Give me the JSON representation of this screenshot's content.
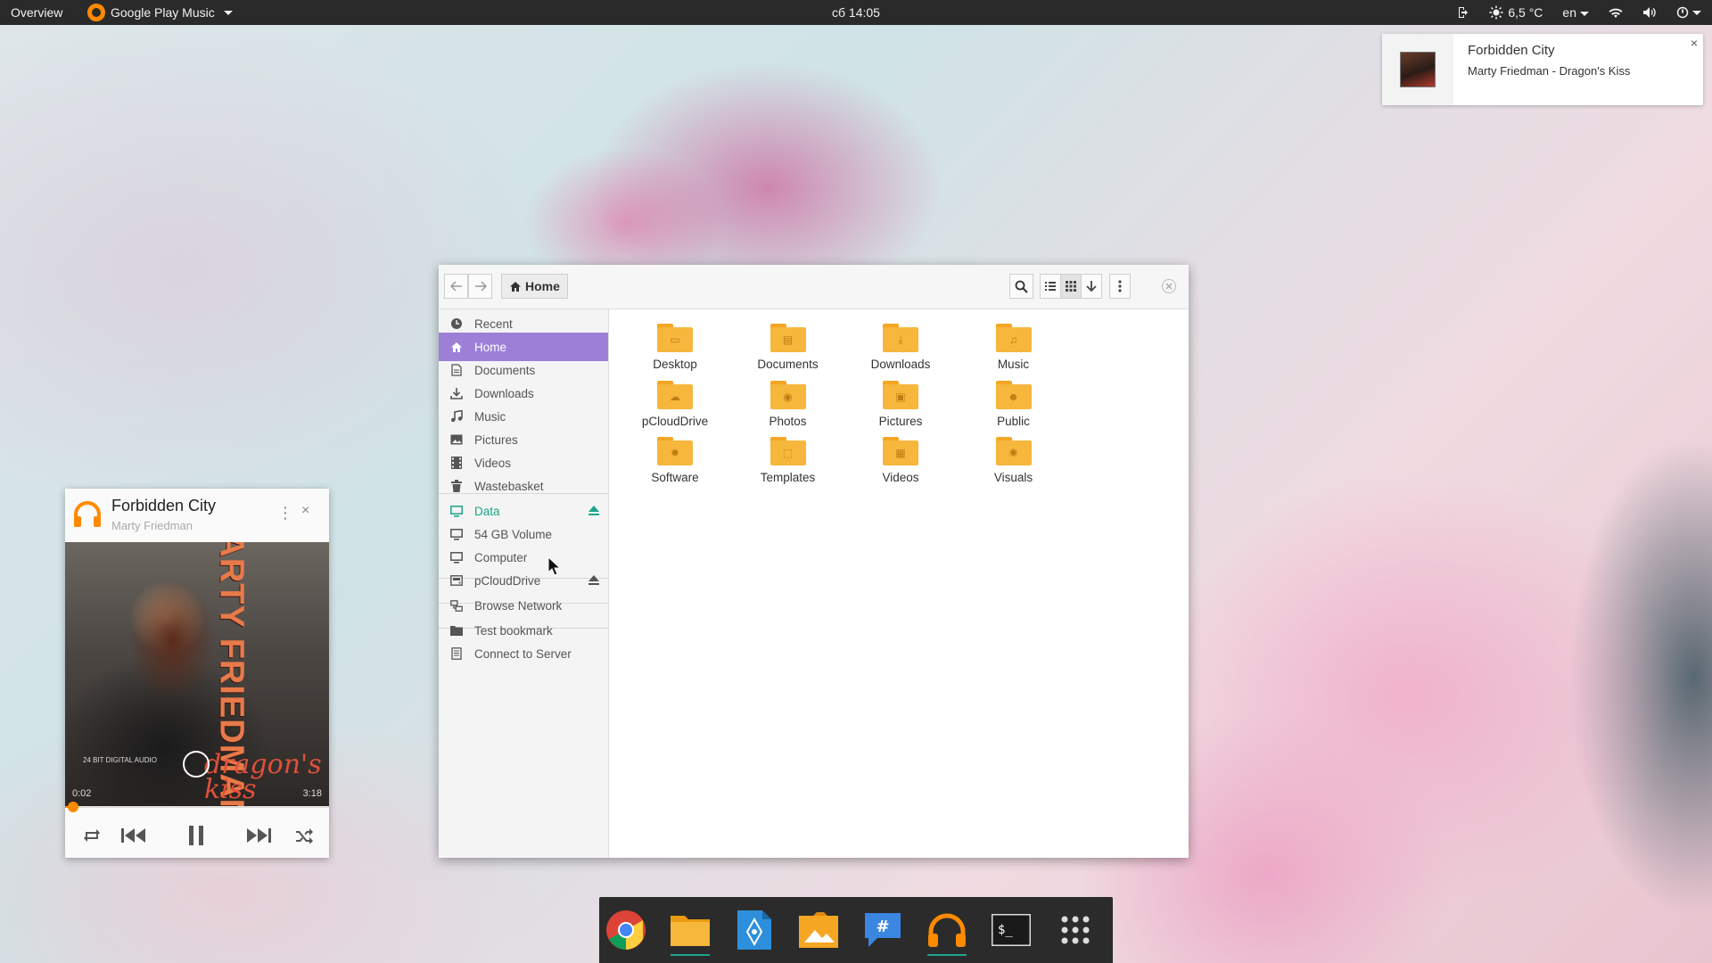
{
  "topbar": {
    "overview": "Overview",
    "app_menu": "Google Play Music",
    "clock": "сб 14:05",
    "weather": "6,5 °C",
    "lang": "en"
  },
  "notification": {
    "title": "Forbidden City",
    "body": "Marty Friedman - Dragon's Kiss",
    "close": "×"
  },
  "player": {
    "title": "Forbidden City",
    "artist": "Marty Friedman",
    "kebab": "⋮",
    "close": "×",
    "album_art": {
      "vertical_text": "MARTY FRIEDMAN",
      "script_text": "dragon's kiss",
      "badge_text": "24 BIT DIGITAL AUDIO",
      "time_left": "0:02",
      "time_right": "3:18"
    },
    "progress": 0.03,
    "accent": "#ff8a00"
  },
  "file_manager": {
    "breadcrumb": "Home",
    "sidebar": [
      {
        "label": "Recent",
        "icon": "clock-icon",
        "state": "normal"
      },
      {
        "label": "Home",
        "icon": "home-icon",
        "state": "active"
      },
      {
        "label": "Documents",
        "icon": "document-icon",
        "state": "normal"
      },
      {
        "label": "Downloads",
        "icon": "download-icon",
        "state": "normal"
      },
      {
        "label": "Music",
        "icon": "music-icon",
        "state": "normal"
      },
      {
        "label": "Pictures",
        "icon": "picture-icon",
        "state": "normal"
      },
      {
        "label": "Videos",
        "icon": "film-icon",
        "state": "normal"
      },
      {
        "label": "Wastebasket",
        "icon": "trash-icon",
        "state": "normal"
      },
      {
        "label": "Data",
        "icon": "monitor-icon",
        "state": "mounted"
      },
      {
        "label": "54 GB Volume",
        "icon": "monitor-icon",
        "state": "normal"
      },
      {
        "label": "Computer",
        "icon": "monitor-icon",
        "state": "normal"
      },
      {
        "label": "pCloudDrive",
        "icon": "drive-icon",
        "state": "normal"
      },
      {
        "label": "Browse Network",
        "icon": "network-icon",
        "state": "normal"
      },
      {
        "label": "Test bookmark",
        "icon": "folder-icon",
        "state": "normal"
      },
      {
        "label": "Connect to Server",
        "icon": "server-icon",
        "state": "normal"
      }
    ],
    "folders": [
      {
        "label": "Desktop",
        "emblem": "desktop"
      },
      {
        "label": "Documents",
        "emblem": "document"
      },
      {
        "label": "Downloads",
        "emblem": "download"
      },
      {
        "label": "Music",
        "emblem": "music"
      },
      {
        "label": "pCloudDrive",
        "emblem": "cloud"
      },
      {
        "label": "Photos",
        "emblem": "camera"
      },
      {
        "label": "Pictures",
        "emblem": "picture"
      },
      {
        "label": "Public",
        "emblem": "people"
      },
      {
        "label": "Software",
        "emblem": "gear"
      },
      {
        "label": "Templates",
        "emblem": "template"
      },
      {
        "label": "Videos",
        "emblem": "film"
      },
      {
        "label": "Visuals",
        "emblem": "palette"
      }
    ],
    "accent": "#9d7fd8",
    "folder_color": "#f7b63c"
  },
  "dock": [
    {
      "name": "chrome",
      "running": false
    },
    {
      "name": "files",
      "running": true
    },
    {
      "name": "text-editor",
      "running": false
    },
    {
      "name": "image-viewer",
      "running": false
    },
    {
      "name": "chat",
      "running": false
    },
    {
      "name": "google-play-music",
      "running": true
    },
    {
      "name": "terminal",
      "running": false
    },
    {
      "name": "app-grid",
      "running": false
    }
  ]
}
